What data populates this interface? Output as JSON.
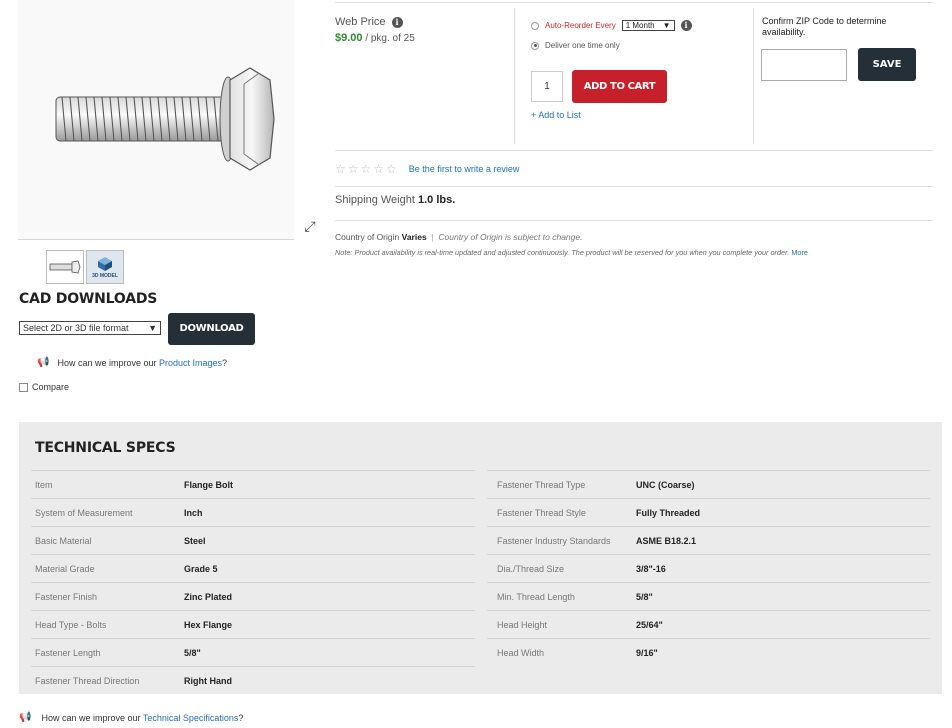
{
  "product": {
    "expand_icon": "expand-arrows-icon",
    "thumb_model_label": "3D MODEL"
  },
  "cad": {
    "title": "CAD DOWNLOADS",
    "select_value": "Select 2D or 3D file format",
    "download_label": "DOWNLOAD",
    "improve_prefix": "How can we improve our",
    "improve_link": "Product Images",
    "improve_suffix": "?",
    "compare_label": "Compare"
  },
  "pricing": {
    "web_price_label": "Web Price",
    "price": "$9.00",
    "unit": "/ pkg. of 25",
    "auto_reorder_label": "Auto-Reorder Every",
    "auto_reorder_value": "1 Month",
    "deliver_once_label": "Deliver one time only",
    "quantity": "1",
    "add_to_cart_label": "ADD TO CART",
    "add_to_list_label": "+ Add to List",
    "zip_label": "Confirm ZIP Code to determine availability.",
    "save_label": "SAVE"
  },
  "details": {
    "review_link": "Be the first to write a review",
    "rating_stars": 0,
    "shipping_label": "Shipping Weight",
    "shipping_value": "1.0 lbs.",
    "origin_label": "Country of Origin",
    "origin_value": "Varies",
    "origin_sep": "|",
    "origin_note": "Country of Origin is subject to change.",
    "availability_note": "Note: Product availability is real-time updated and adjusted continuously. The product will be reserved for you when you complete your order.",
    "more_link": "More"
  },
  "specs": {
    "title": "TECHNICAL SPECS",
    "left": [
      {
        "name": "Item",
        "value": "Flange Bolt"
      },
      {
        "name": "System of Measurement",
        "value": "Inch"
      },
      {
        "name": "Basic Material",
        "value": "Steel"
      },
      {
        "name": "Material Grade",
        "value": "Grade 5"
      },
      {
        "name": "Fastener Finish",
        "value": "Zinc Plated"
      },
      {
        "name": "Head Type - Bolts",
        "value": "Hex Flange"
      },
      {
        "name": "Fastener Length",
        "value": "5/8\""
      },
      {
        "name": "Fastener Thread Direction",
        "value": "Right Hand"
      }
    ],
    "right": [
      {
        "name": "Fastener Thread Type",
        "value": "UNC (Coarse)"
      },
      {
        "name": "Fastener Thread Style",
        "value": "Fully Threaded"
      },
      {
        "name": "Fastener Industry Standards",
        "value": "ASME B18.2.1"
      },
      {
        "name": "Dia./Thread Size",
        "value": "3/8\"-16"
      },
      {
        "name": "Min. Thread Length",
        "value": "5/8\""
      },
      {
        "name": "Head Height",
        "value": "25/64\""
      },
      {
        "name": "Head Width",
        "value": "9/16\""
      }
    ],
    "improve_prefix": "How can we improve our",
    "improve_link": "Technical Specifications",
    "improve_suffix": "?"
  },
  "colors": {
    "price_green": "#2e8b2e",
    "cart_red": "#c8202a",
    "dark_button": "#242f38",
    "link_blue": "#1f6fb5",
    "specs_bg": "#ebebeb"
  }
}
